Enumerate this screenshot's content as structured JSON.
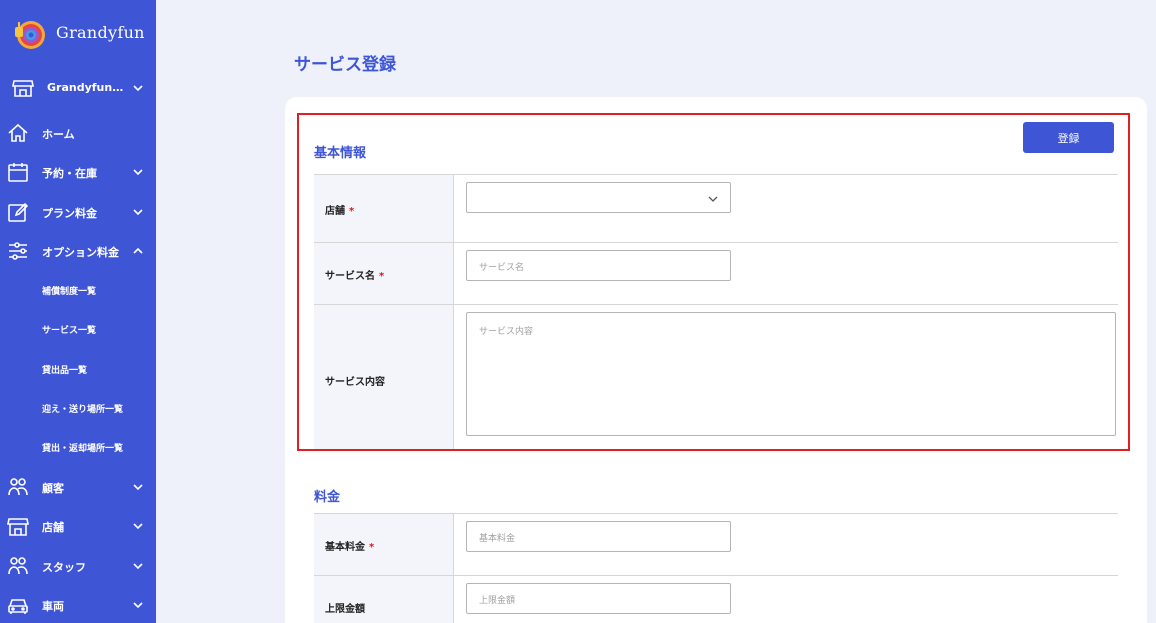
{
  "brand": {
    "name": "Grandyfun"
  },
  "store_selector": {
    "label": "Grandyfun…",
    "icon": "store-icon"
  },
  "nav": [
    {
      "label": "ホーム",
      "icon": "home-icon",
      "expanded": null
    },
    {
      "label": "予約・在庫",
      "icon": "calendar-icon",
      "expanded": false
    },
    {
      "label": "プラン料金",
      "icon": "edit-icon",
      "expanded": false
    },
    {
      "label": "オプション料金",
      "icon": "sliders-icon",
      "expanded": true
    },
    {
      "label": "顧客",
      "icon": "users-icon",
      "expanded": false
    },
    {
      "label": "店舗",
      "icon": "store-icon",
      "expanded": false
    },
    {
      "label": "スタッフ",
      "icon": "staff-icon",
      "expanded": false
    },
    {
      "label": "車両",
      "icon": "car-icon",
      "expanded": false
    }
  ],
  "option_submenu": [
    "補償制度一覧",
    "サービス一覧",
    "貸出品一覧",
    "迎え・送り場所一覧",
    "貸出・返却場所一覧"
  ],
  "page": {
    "title": "サービス登録"
  },
  "basic": {
    "title": "基本情報",
    "submit_label": "登録",
    "store_label": "店舗",
    "required_mark": "*",
    "store_value": "",
    "service_name_label": "サービス名",
    "service_name_placeholder": "サービス名",
    "service_desc_label": "サービス内容",
    "service_desc_placeholder": "サービス内容"
  },
  "pricing": {
    "title": "料金",
    "base_fee_label": "基本料金",
    "base_fee_placeholder": "基本料金",
    "max_amount_label": "上限金額",
    "max_amount_placeholder": "上限金額"
  },
  "colors": {
    "accent": "#3e55d6",
    "required": "#e01818",
    "highlight": "#e02020",
    "background": "#eef1f9"
  }
}
